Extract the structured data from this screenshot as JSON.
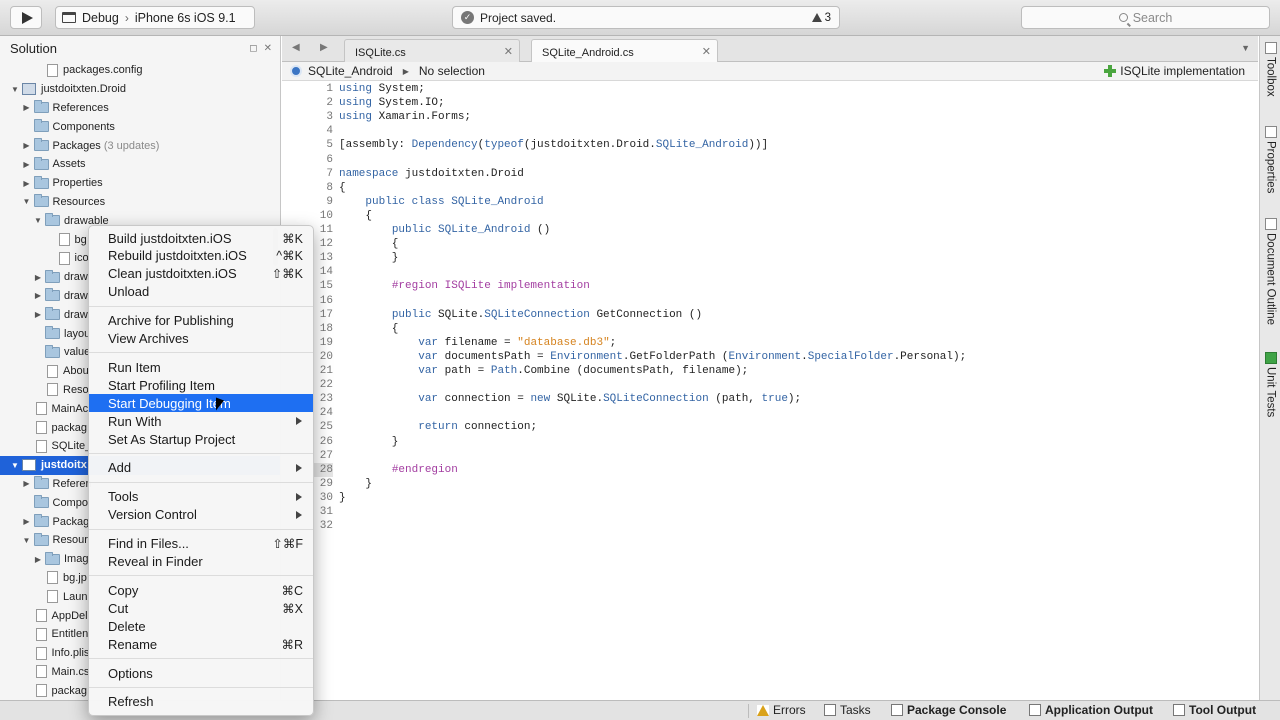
{
  "toolbar": {
    "config": "Debug",
    "device": "iPhone 6s iOS 9.1",
    "status": "Project saved.",
    "warnings": "3",
    "search_placeholder": "Search"
  },
  "solution": {
    "title": "Solution",
    "rows": [
      {
        "label": "packages.config",
        "kind": "file",
        "depth": 2,
        "disc": ""
      },
      {
        "label": "justdoitxten.Droid",
        "kind": "proj",
        "depth": 0,
        "disc": "▼"
      },
      {
        "label": "References",
        "kind": "folder",
        "depth": 1,
        "disc": "▶"
      },
      {
        "label": "Components",
        "kind": "folder",
        "depth": 1,
        "disc": ""
      },
      {
        "label": "Packages",
        "kind": "folder",
        "depth": 1,
        "disc": "▶",
        "extra": "(3 updates)"
      },
      {
        "label": "Assets",
        "kind": "folder",
        "depth": 1,
        "disc": "▶"
      },
      {
        "label": "Properties",
        "kind": "folder",
        "depth": 1,
        "disc": "▶"
      },
      {
        "label": "Resources",
        "kind": "folder",
        "depth": 1,
        "disc": "▼"
      },
      {
        "label": "drawable",
        "kind": "folder",
        "depth": 2,
        "disc": "▼"
      },
      {
        "label": "bg",
        "kind": "file",
        "depth": 3,
        "disc": ""
      },
      {
        "label": "ico",
        "kind": "file",
        "depth": 3,
        "disc": ""
      },
      {
        "label": "draw",
        "kind": "folder",
        "depth": 2,
        "disc": "▶"
      },
      {
        "label": "draw",
        "kind": "folder",
        "depth": 2,
        "disc": "▶"
      },
      {
        "label": "draw",
        "kind": "folder",
        "depth": 2,
        "disc": "▶"
      },
      {
        "label": "layou",
        "kind": "folder",
        "depth": 2,
        "disc": ""
      },
      {
        "label": "value",
        "kind": "folder",
        "depth": 2,
        "disc": ""
      },
      {
        "label": "Abou",
        "kind": "file",
        "depth": 2,
        "disc": ""
      },
      {
        "label": "Reso",
        "kind": "file",
        "depth": 2,
        "disc": ""
      },
      {
        "label": "MainAc",
        "kind": "file",
        "depth": 1,
        "disc": ""
      },
      {
        "label": "packag",
        "kind": "file",
        "depth": 1,
        "disc": ""
      },
      {
        "label": "SQLite_",
        "kind": "file",
        "depth": 1,
        "disc": ""
      },
      {
        "label": "justdoitx",
        "kind": "proj",
        "depth": 0,
        "disc": "▼",
        "selected": true
      },
      {
        "label": "Referen",
        "kind": "folder",
        "depth": 1,
        "disc": "▶"
      },
      {
        "label": "Compo",
        "kind": "folder",
        "depth": 1,
        "disc": ""
      },
      {
        "label": "Packag",
        "kind": "folder",
        "depth": 1,
        "disc": "▶"
      },
      {
        "label": "Resour",
        "kind": "folder",
        "depth": 1,
        "disc": "▼"
      },
      {
        "label": "Imag",
        "kind": "folder",
        "depth": 2,
        "disc": "▶"
      },
      {
        "label": "bg.jp",
        "kind": "file",
        "depth": 2,
        "disc": ""
      },
      {
        "label": "Laun",
        "kind": "file",
        "depth": 2,
        "disc": ""
      },
      {
        "label": "AppDel",
        "kind": "file",
        "depth": 1,
        "disc": ""
      },
      {
        "label": "Entitlen",
        "kind": "file",
        "depth": 1,
        "disc": ""
      },
      {
        "label": "Info.plis",
        "kind": "file",
        "depth": 1,
        "disc": ""
      },
      {
        "label": "Main.cs",
        "kind": "file",
        "depth": 1,
        "disc": ""
      },
      {
        "label": "packag",
        "kind": "file",
        "depth": 1,
        "disc": ""
      }
    ]
  },
  "tabs": [
    {
      "label": "ISQLite.cs",
      "active": false
    },
    {
      "label": "SQLite_Android.cs",
      "active": true
    }
  ],
  "pathbar": {
    "class_name": "SQLite_Android",
    "member": "No selection",
    "region": "ISQLite implementation"
  },
  "code": [
    {
      "n": "1",
      "t": "using System;",
      "h": [
        [
          "kw",
          "using"
        ],
        [
          "",
          "System;"
        ]
      ]
    },
    {
      "n": "2",
      "t": "",
      "h": [
        [
          "kw",
          "using"
        ],
        [
          "",
          " System.IO;"
        ]
      ]
    },
    {
      "n": "3",
      "t": "",
      "h": [
        [
          "kw",
          "using"
        ],
        [
          "",
          " Xamarin.Forms;"
        ]
      ]
    },
    {
      "n": "4",
      "t": "",
      "h": []
    },
    {
      "n": "5",
      "t": "",
      "h": [
        [
          "",
          "[assembly: "
        ],
        [
          "ty",
          "Dependency"
        ],
        [
          "",
          "("
        ],
        [
          "kw",
          "typeof"
        ],
        [
          "",
          "(justdoitxten.Droid."
        ],
        [
          "ty",
          "SQLite_Android"
        ],
        [
          "",
          "))]"
        ]
      ]
    },
    {
      "n": "6",
      "t": "",
      "h": []
    },
    {
      "n": "7",
      "t": "",
      "h": [
        [
          "kw",
          "namespace"
        ],
        [
          "",
          " justdoitxten.Droid"
        ]
      ]
    },
    {
      "n": "8",
      "t": "",
      "h": [
        [
          "",
          "{"
        ]
      ]
    },
    {
      "n": "9",
      "t": "",
      "h": [
        [
          "",
          "    "
        ],
        [
          "kw",
          "public class"
        ],
        [
          "",
          " "
        ],
        [
          "ty",
          "SQLite_Android"
        ]
      ]
    },
    {
      "n": "10",
      "t": "",
      "h": [
        [
          "",
          "    {"
        ]
      ]
    },
    {
      "n": "11",
      "t": "",
      "h": [
        [
          "",
          "        "
        ],
        [
          "kw",
          "public"
        ],
        [
          "",
          " "
        ],
        [
          "ty",
          "SQLite_Android"
        ],
        [
          "",
          " ()"
        ]
      ]
    },
    {
      "n": "12",
      "t": "",
      "h": [
        [
          "",
          "        {"
        ]
      ]
    },
    {
      "n": "13",
      "t": "",
      "h": [
        [
          "",
          "        }"
        ]
      ]
    },
    {
      "n": "14",
      "t": "",
      "h": []
    },
    {
      "n": "15",
      "t": "",
      "h": [
        [
          "",
          "        "
        ],
        [
          "pp",
          "#region ISQLite implementation"
        ]
      ]
    },
    {
      "n": "16",
      "t": "",
      "h": []
    },
    {
      "n": "17",
      "t": "",
      "h": [
        [
          "",
          "        "
        ],
        [
          "kw",
          "public"
        ],
        [
          "",
          " SQLite."
        ],
        [
          "ty",
          "SQLiteConnection"
        ],
        [
          "",
          " GetConnection ()"
        ]
      ]
    },
    {
      "n": "18",
      "t": "",
      "h": [
        [
          "",
          "        {"
        ]
      ]
    },
    {
      "n": "19",
      "t": "",
      "h": [
        [
          "",
          "            "
        ],
        [
          "kw",
          "var"
        ],
        [
          "",
          " filename = "
        ],
        [
          "str",
          "\"database.db3\""
        ],
        [
          "",
          ";"
        ]
      ]
    },
    {
      "n": "20",
      "t": "",
      "h": [
        [
          "",
          "            "
        ],
        [
          "kw",
          "var"
        ],
        [
          "",
          " documentsPath = "
        ],
        [
          "ty",
          "Environment"
        ],
        [
          "",
          ".GetFolderPath ("
        ],
        [
          "ty",
          "Environment"
        ],
        [
          "",
          "."
        ],
        [
          "ty",
          "SpecialFolder"
        ],
        [
          "",
          ".Personal);"
        ]
      ]
    },
    {
      "n": "21",
      "t": "",
      "h": [
        [
          "",
          "            "
        ],
        [
          "kw",
          "var"
        ],
        [
          "",
          " path = "
        ],
        [
          "ty",
          "Path"
        ],
        [
          "",
          ".Combine (documentsPath, filename);"
        ]
      ]
    },
    {
      "n": "22",
      "t": "",
      "h": []
    },
    {
      "n": "23",
      "t": "",
      "h": [
        [
          "",
          "            "
        ],
        [
          "kw",
          "var"
        ],
        [
          "",
          " connection = "
        ],
        [
          "kw",
          "new"
        ],
        [
          "",
          " SQLite."
        ],
        [
          "ty",
          "SQLiteConnection"
        ],
        [
          "",
          " (path, "
        ],
        [
          "lit",
          "true"
        ],
        [
          "",
          ");"
        ]
      ]
    },
    {
      "n": "24",
      "t": "",
      "h": []
    },
    {
      "n": "25",
      "t": "",
      "h": [
        [
          "",
          "            "
        ],
        [
          "kw",
          "return"
        ],
        [
          "",
          " connection;"
        ]
      ]
    },
    {
      "n": "26",
      "t": "",
      "h": [
        [
          "",
          "        }"
        ]
      ]
    },
    {
      "n": "27",
      "t": "",
      "h": []
    },
    {
      "n": "28",
      "t": "",
      "h": [
        [
          "",
          "        "
        ],
        [
          "pp",
          "#endregion"
        ]
      ],
      "current": true
    },
    {
      "n": "29",
      "t": "",
      "h": [
        [
          "",
          "    }"
        ]
      ]
    },
    {
      "n": "30",
      "t": "",
      "h": [
        [
          "",
          "}"
        ]
      ]
    },
    {
      "n": "31",
      "t": "",
      "h": []
    },
    {
      "n": "32",
      "t": "",
      "h": []
    }
  ],
  "dock": [
    "Toolbox",
    "Properties",
    "Document Outline",
    "Unit Tests"
  ],
  "bottom": [
    "Errors",
    "Tasks",
    "Package Console",
    "Application Output",
    "Tool Output"
  ],
  "menu": [
    {
      "label": "Build justdoitxten.iOS",
      "sc": "⌘K"
    },
    {
      "label": "Rebuild justdoitxten.iOS",
      "sc": "^⌘K"
    },
    {
      "label": "Clean justdoitxten.iOS",
      "sc": "⇧⌘K"
    },
    {
      "label": "Unload",
      "sc": ""
    },
    {
      "sep": true
    },
    {
      "label": "Archive for Publishing",
      "sc": ""
    },
    {
      "label": "View Archives",
      "sc": ""
    },
    {
      "sep": true
    },
    {
      "label": "Run Item",
      "sc": ""
    },
    {
      "label": "Start Profiling Item",
      "sc": ""
    },
    {
      "label": "Start Debugging Item",
      "sc": "",
      "hl": true
    },
    {
      "label": "Run With",
      "sub": true
    },
    {
      "label": "Set As Startup Project",
      "sc": ""
    },
    {
      "sep": true
    },
    {
      "label": "Add",
      "sub": true
    },
    {
      "sep": true
    },
    {
      "label": "Tools",
      "sub": true
    },
    {
      "label": "Version Control",
      "sub": true
    },
    {
      "sep": true
    },
    {
      "label": "Find in Files...",
      "sc": "⇧⌘F"
    },
    {
      "label": "Reveal in Finder",
      "sc": ""
    },
    {
      "sep": true
    },
    {
      "label": "Copy",
      "sc": "⌘C"
    },
    {
      "label": "Cut",
      "sc": "⌘X"
    },
    {
      "label": "Delete",
      "sc": ""
    },
    {
      "label": "Rename",
      "sc": "⌘R"
    },
    {
      "sep": true
    },
    {
      "label": "Options",
      "sc": ""
    },
    {
      "sep": true
    },
    {
      "label": "Refresh",
      "sc": ""
    }
  ]
}
